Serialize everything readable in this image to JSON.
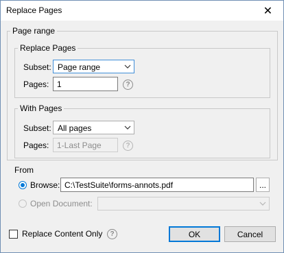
{
  "window": {
    "title": "Replace Pages",
    "close_icon": "close-icon"
  },
  "page_range": {
    "legend": "Page range",
    "replace_pages": {
      "legend": "Replace Pages",
      "subset_label": "Subset:",
      "subset_value": "Page range",
      "pages_label": "Pages:",
      "pages_value": "1"
    },
    "with_pages": {
      "legend": "With Pages",
      "subset_label": "Subset:",
      "subset_value": "All pages",
      "pages_label": "Pages:",
      "pages_value": "1-Last Page"
    }
  },
  "from": {
    "label": "From",
    "browse_label": "Browse:",
    "browse_path": "C:\\TestSuite\\forms-annots.pdf",
    "browse_button": "...",
    "open_document_label": "Open Document:",
    "open_document_value": ""
  },
  "footer": {
    "replace_content_only": "Replace Content Only",
    "replace_content_only_checked": false,
    "ok": "OK",
    "cancel": "Cancel"
  },
  "colors": {
    "accent": "#0078d7",
    "disabled_text": "#8d8d8d"
  }
}
